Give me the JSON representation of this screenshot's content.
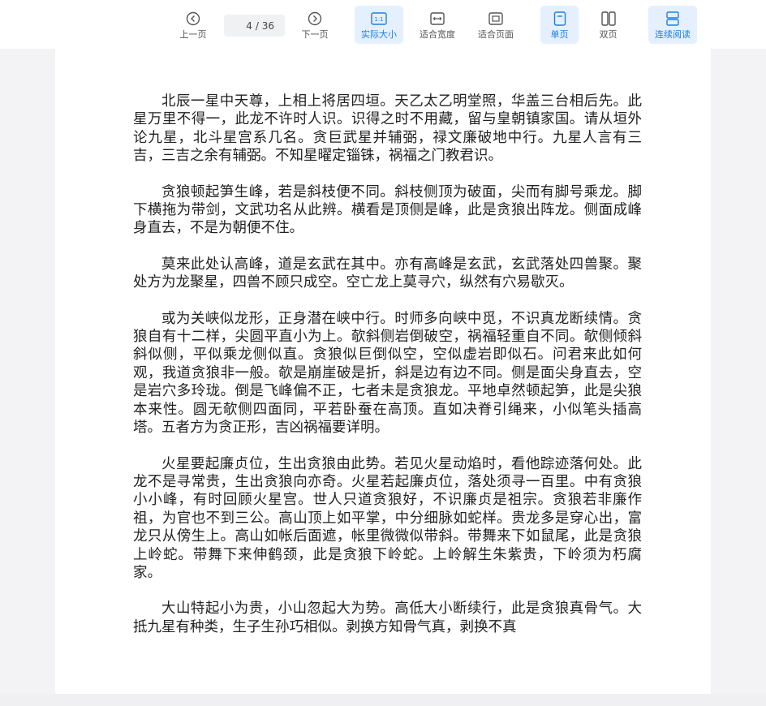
{
  "toolbar": {
    "prev_label": "上一页",
    "next_label": "下一页",
    "current_page": "4",
    "total_pages": "/ 36",
    "actual_size_label": "实际大小",
    "actual_size_badge": "1:1",
    "fit_width_label": "适合宽度",
    "fit_page_label": "适合页面",
    "single_page_label": "单页",
    "double_page_label": "双页",
    "continuous_label": "连续阅读"
  },
  "colors": {
    "accent": "#1d7fe6",
    "active_bg": "#e4f0fd",
    "text": "#222222"
  },
  "document": {
    "paragraphs": [
      "北辰一星中天尊，上相上将居四垣。天乙太乙明堂照，华盖三台相后先。此星万里不得一，此龙不许时人识。识得之时不用藏，留与皇朝镇家国。请从垣外论九星，北斗星宫系几名。贪巨武星并辅弼，禄文廉破地中行。九星人言有三吉，三吉之余有辅弼。不知星曜定锱铢，祸福之门教君识。",
      "贪狼顿起笋生峰，若是斜枝便不同。斜枝侧顶为破面，尖而有脚号乘龙。脚下横拖为带剑，文武功名从此辨。横看是顶侧是峰，此是贪狼出阵龙。侧面成峰身直去，不是为朝便不住。",
      "莫来此处认高峰，道是玄武在其中。亦有高峰是玄武，玄武落处四兽聚。聚处方为龙聚星，四兽不顾只成空。空亡龙上莫寻穴，纵然有穴易歇灭。",
      "或为关峡似龙形，正身潜在峡中行。时师多向峡中觅，不识真龙断续情。贪狼自有十二样，尖圆平直小为上。欹斜侧岩倒破空，祸福轻重自不同。欹侧倾斜斜似侧，平似乘龙侧似直。贪狼似巨倒似空，空似虚岩即似石。问君来此如何观，我道贪狼非一般。欹是崩崖破是折，斜是边有边不同。侧是面尖身直去，空是岩穴多玲珑。倒是飞峰偏不正，七者未是贪狼龙。平地卓然顿起笋，此是尖狼本来性。圆无欹侧四面同，平若卧蚕在高顶。直如决脊引绳来，小似笔头插高塔。五者方为贪正形，吉凶祸福要详明。",
      "火星要起廉贞位，生出贪狼由此势。若见火星动焰时，看他踪迹落何处。此龙不是寻常贵，生出贪狼向亦奇。火星若起廉贞位，落处须寻一百里。中有贪狼小小峰，有时回顾火星宫。世人只道贪狼好，不识廉贞是祖宗。贪狼若非廉作祖，为官也不到三公。高山顶上如平掌，中分细脉如蛇样。贵龙多是穿心出，富龙只从傍生上。高山如帐后面遮，帐里微微似带斜。带舞来下如鼠尾，此是贪狼上岭蛇。带舞下来伸鹤颈，此是贪狼下岭蛇。上岭解生朱紫贵，下岭须为朽腐家。",
      "大山特起小为贵，小山忽起大为势。高低大小断续行，此是贪狼真骨气。大抵九星有种类，生子生孙巧相似。剥换方知骨气真，剥换不真"
    ]
  }
}
